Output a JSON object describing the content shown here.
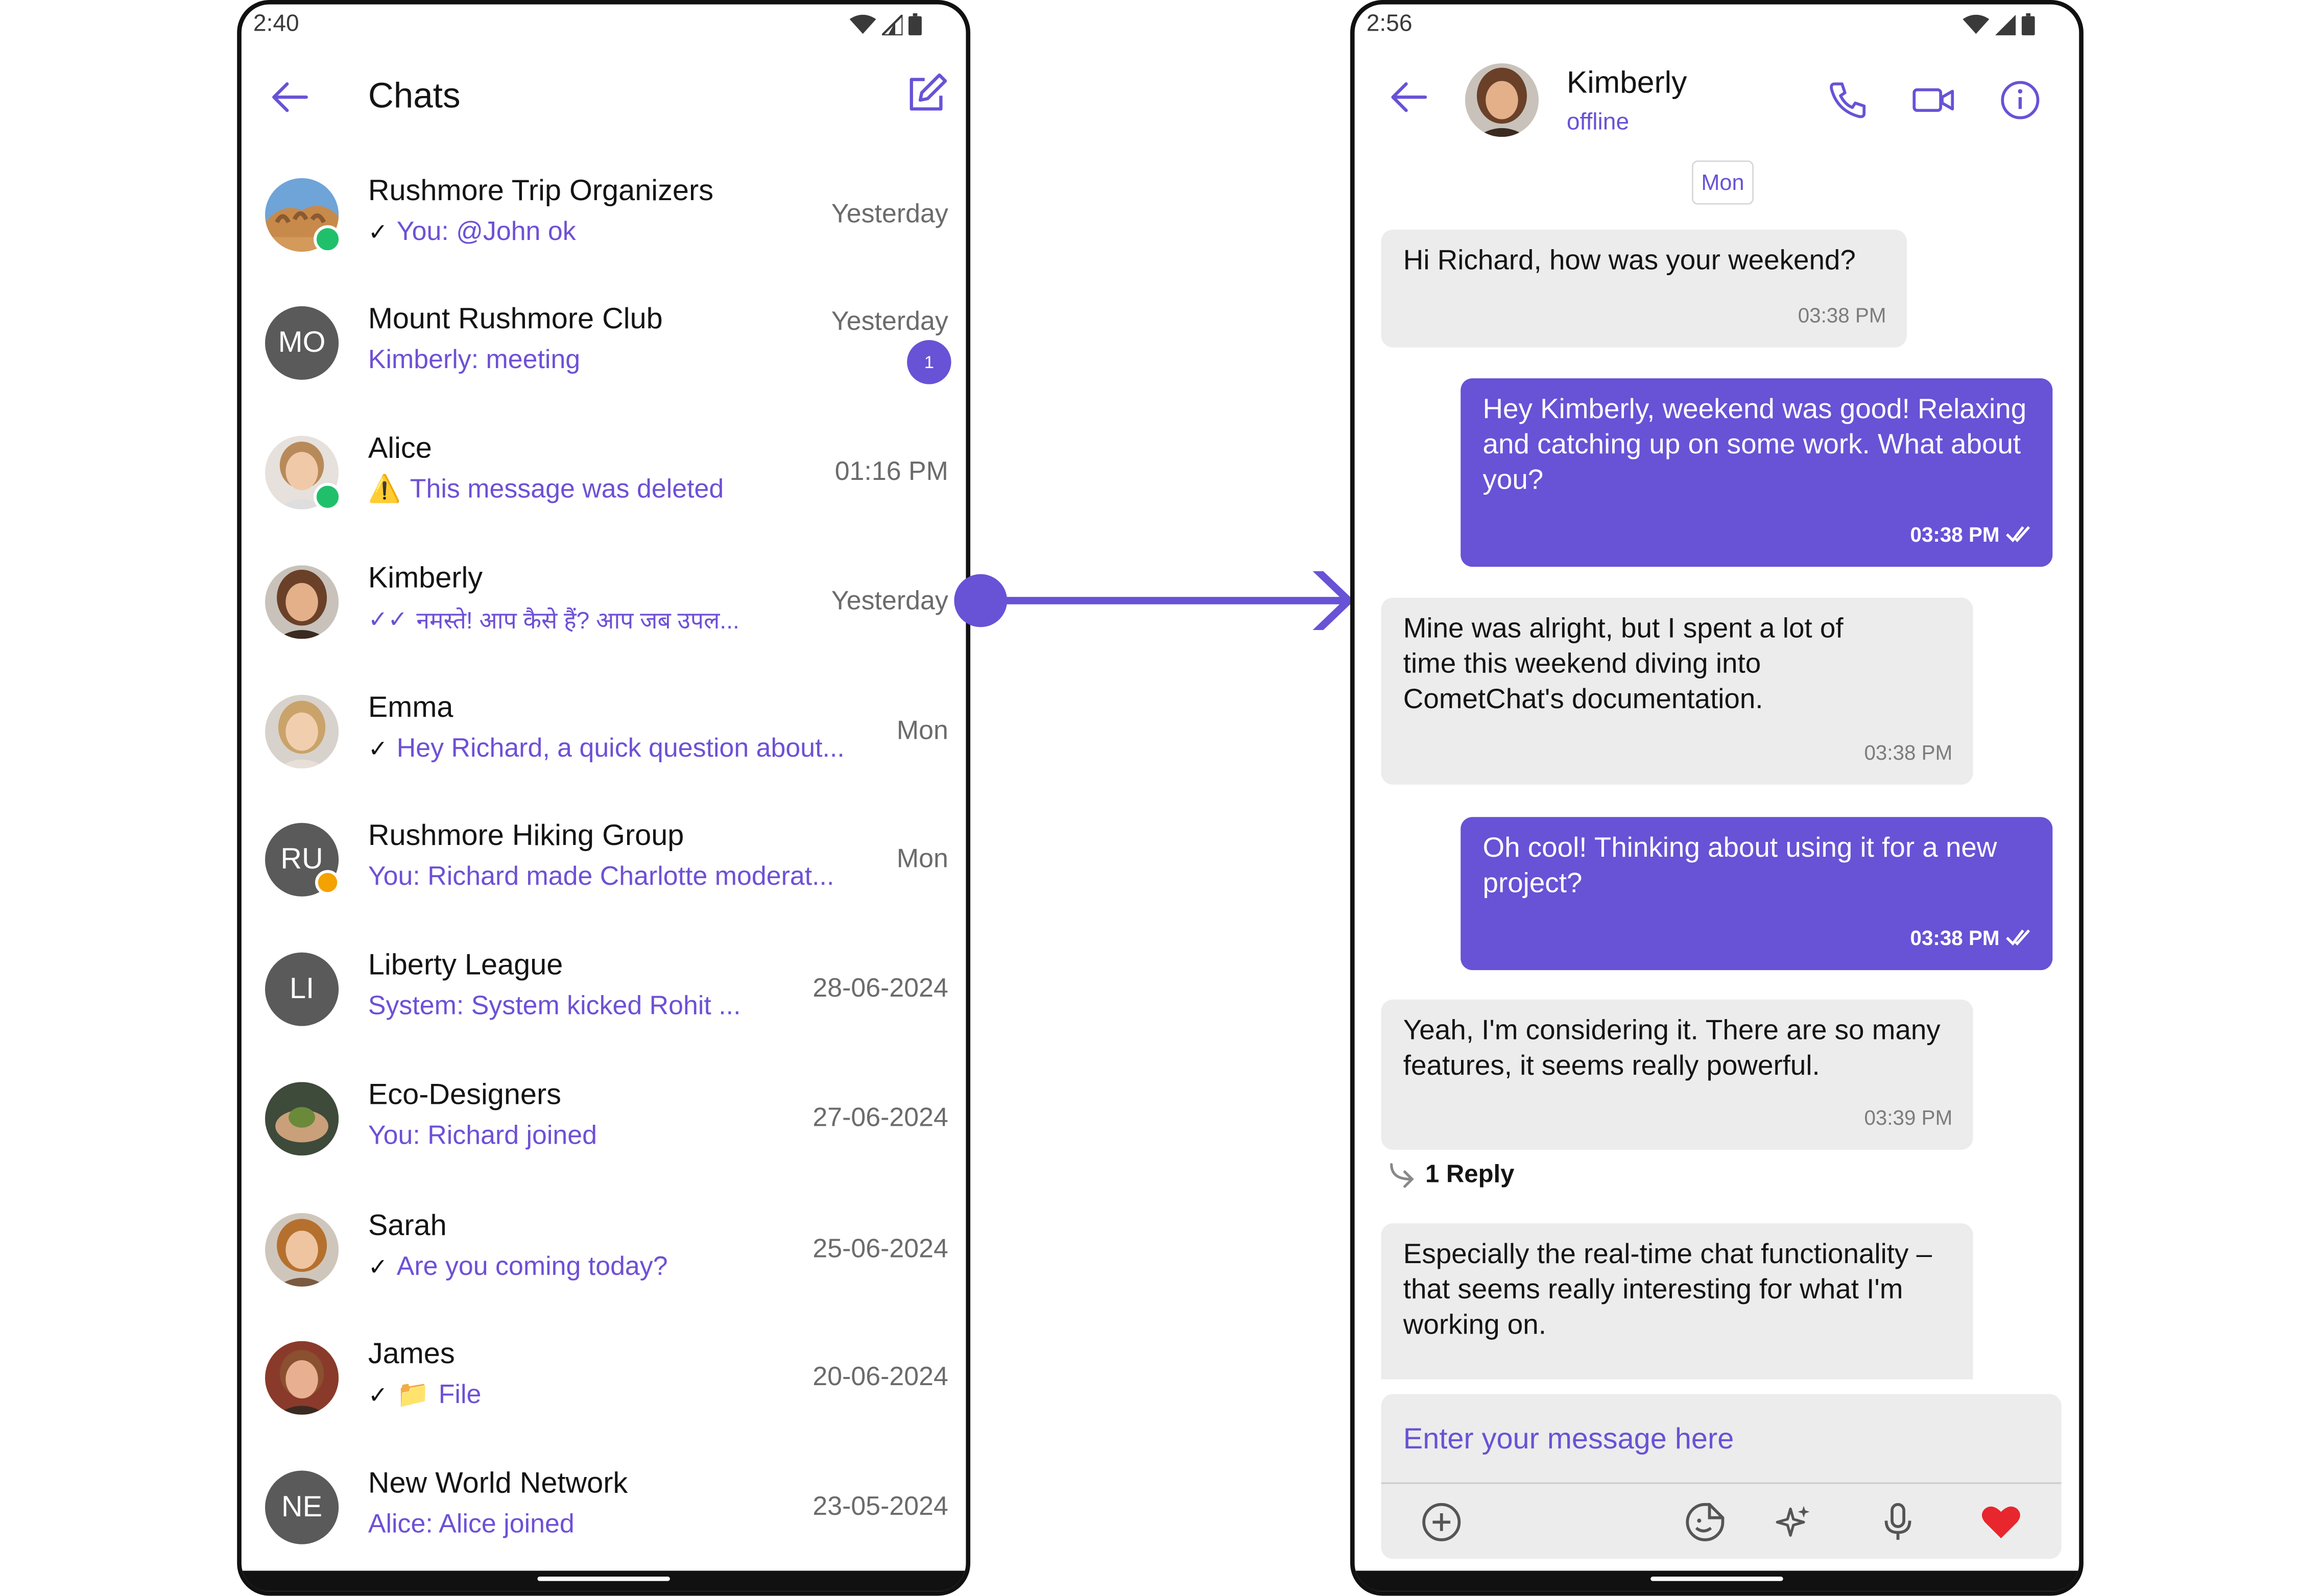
{
  "left_phone": {
    "status_time": "2:40",
    "title": "Chats",
    "conversations": [
      {
        "name": "Rushmore Trip Organizers",
        "preview": "You: @John ok",
        "time": "Yesterday",
        "tick": "✓"
      },
      {
        "name": "Mount Rushmore Club",
        "initials": "MO",
        "preview": "Kimberly: meeting",
        "time": "Yesterday",
        "unread": "1"
      },
      {
        "name": "Alice",
        "preview": "This message was deleted",
        "warning": "⚠️",
        "time": "01:16 PM"
      },
      {
        "name": "Kimberly",
        "preview": "नमस्ते! आप कैसे हैं?  आप जब उपल...",
        "time": "Yesterday",
        "tick": "✓✓"
      },
      {
        "name": "Emma",
        "preview": "Hey Richard, a quick question about...",
        "time": "Mon",
        "tick": "✓"
      },
      {
        "name": "Rushmore Hiking Group",
        "initials": "RU",
        "preview": "You: Richard made Charlotte moderat...",
        "time": "Mon"
      },
      {
        "name": "Liberty League",
        "initials": "LI",
        "preview": "System: System kicked Rohit ...",
        "time": "28-06-2024"
      },
      {
        "name": "Eco-Designers",
        "preview": "You: Richard joined",
        "time": "27-06-2024"
      },
      {
        "name": "Sarah",
        "preview": "Are you coming today?",
        "time": "25-06-2024",
        "tick": "✓"
      },
      {
        "name": "James",
        "preview": "File",
        "file_icon": "📁",
        "time": "20-06-2024",
        "tick": "✓"
      },
      {
        "name": "New World Network",
        "initials": "NE",
        "preview": "Alice: Alice joined",
        "time": "23-05-2024"
      }
    ]
  },
  "right_phone": {
    "status_time": "2:56",
    "contact_name": "Kimberly",
    "contact_status": "offline",
    "day_chip": "Mon",
    "messages": [
      {
        "text": "Hi Richard, how was your weekend?",
        "time": "03:38 PM"
      },
      {
        "text": "Hey Kimberly, weekend was good! Relaxing and catching up on some work. What about you?",
        "time": "03:38 PM"
      },
      {
        "text": "Mine was alright, but I spent a lot of time this weekend diving into CometChat's documentation.",
        "time": "03:38 PM"
      },
      {
        "text": "Oh cool! Thinking about using it for a new project?",
        "time": "03:38 PM"
      },
      {
        "text": "Yeah, I'm considering it.  There are so many features, it seems really powerful.",
        "time": "03:39 PM"
      },
      {
        "text": "Especially the real-time chat functionality – that seems really interesting for what I'm working on."
      }
    ],
    "reply_count": "1 Reply",
    "composer_placeholder": "Enter your message here"
  },
  "colors": {
    "accent": "#6852d6",
    "incoming_bubble": "#ececec",
    "online": "#20c06a",
    "heart": "#e8262d"
  },
  "icons": [
    "back-arrow-icon",
    "compose-icon",
    "phone-icon",
    "video-icon",
    "info-icon",
    "plus-icon",
    "sticker-icon",
    "ai-sparkle-icon",
    "mic-icon",
    "heart-icon",
    "double-tick-icon",
    "reply-arrow-icon"
  ]
}
